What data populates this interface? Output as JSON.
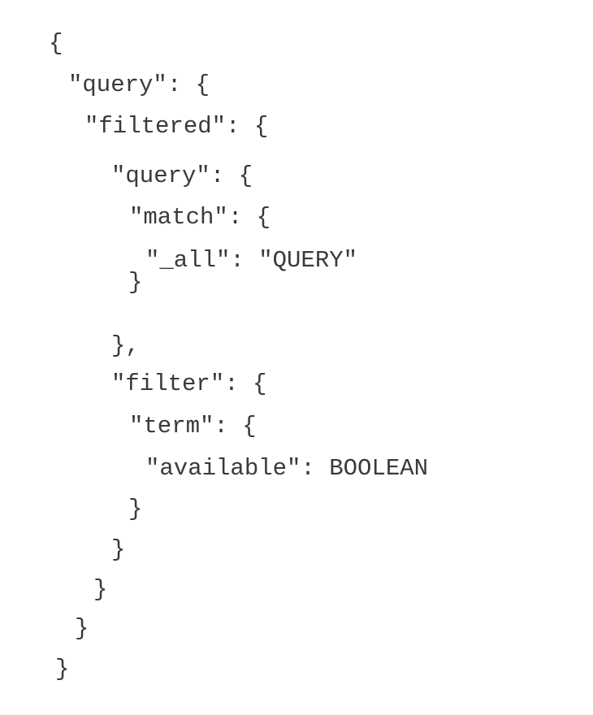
{
  "code": {
    "lines": [
      "{",
      "\"query\": {",
      "\"filtered\": {",
      "\"query\": {",
      "\"match\": {",
      "\"_all\": \"QUERY\"",
      "}",
      "},",
      "\"filter\": {",
      "\"term\": {",
      "\"available\": BOOLEAN",
      "}",
      "}",
      "}",
      "}",
      "}"
    ]
  }
}
